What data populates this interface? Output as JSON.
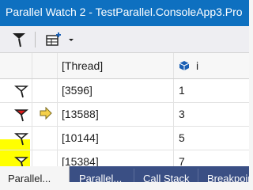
{
  "window": {
    "title": "Parallel Watch 2 - TestParallel.ConsoleApp3.Pro"
  },
  "columns": {
    "thread": "[Thread]",
    "watch": "i"
  },
  "rows": [
    {
      "thread": "[3596]",
      "value": "1"
    },
    {
      "thread": "[13588]",
      "value": "3"
    },
    {
      "thread": "[10144]",
      "value": "5"
    },
    {
      "thread": "[15384]",
      "value": "7"
    }
  ],
  "tabs": [
    "Parallel...",
    "Parallel...",
    "Call Stack",
    "Breakpoints"
  ],
  "colors": {
    "title_bar": "#0e70c0",
    "highlight": "#ffff00",
    "flag_red": "#e21b1b",
    "tab_strip": "#3a4f84"
  }
}
